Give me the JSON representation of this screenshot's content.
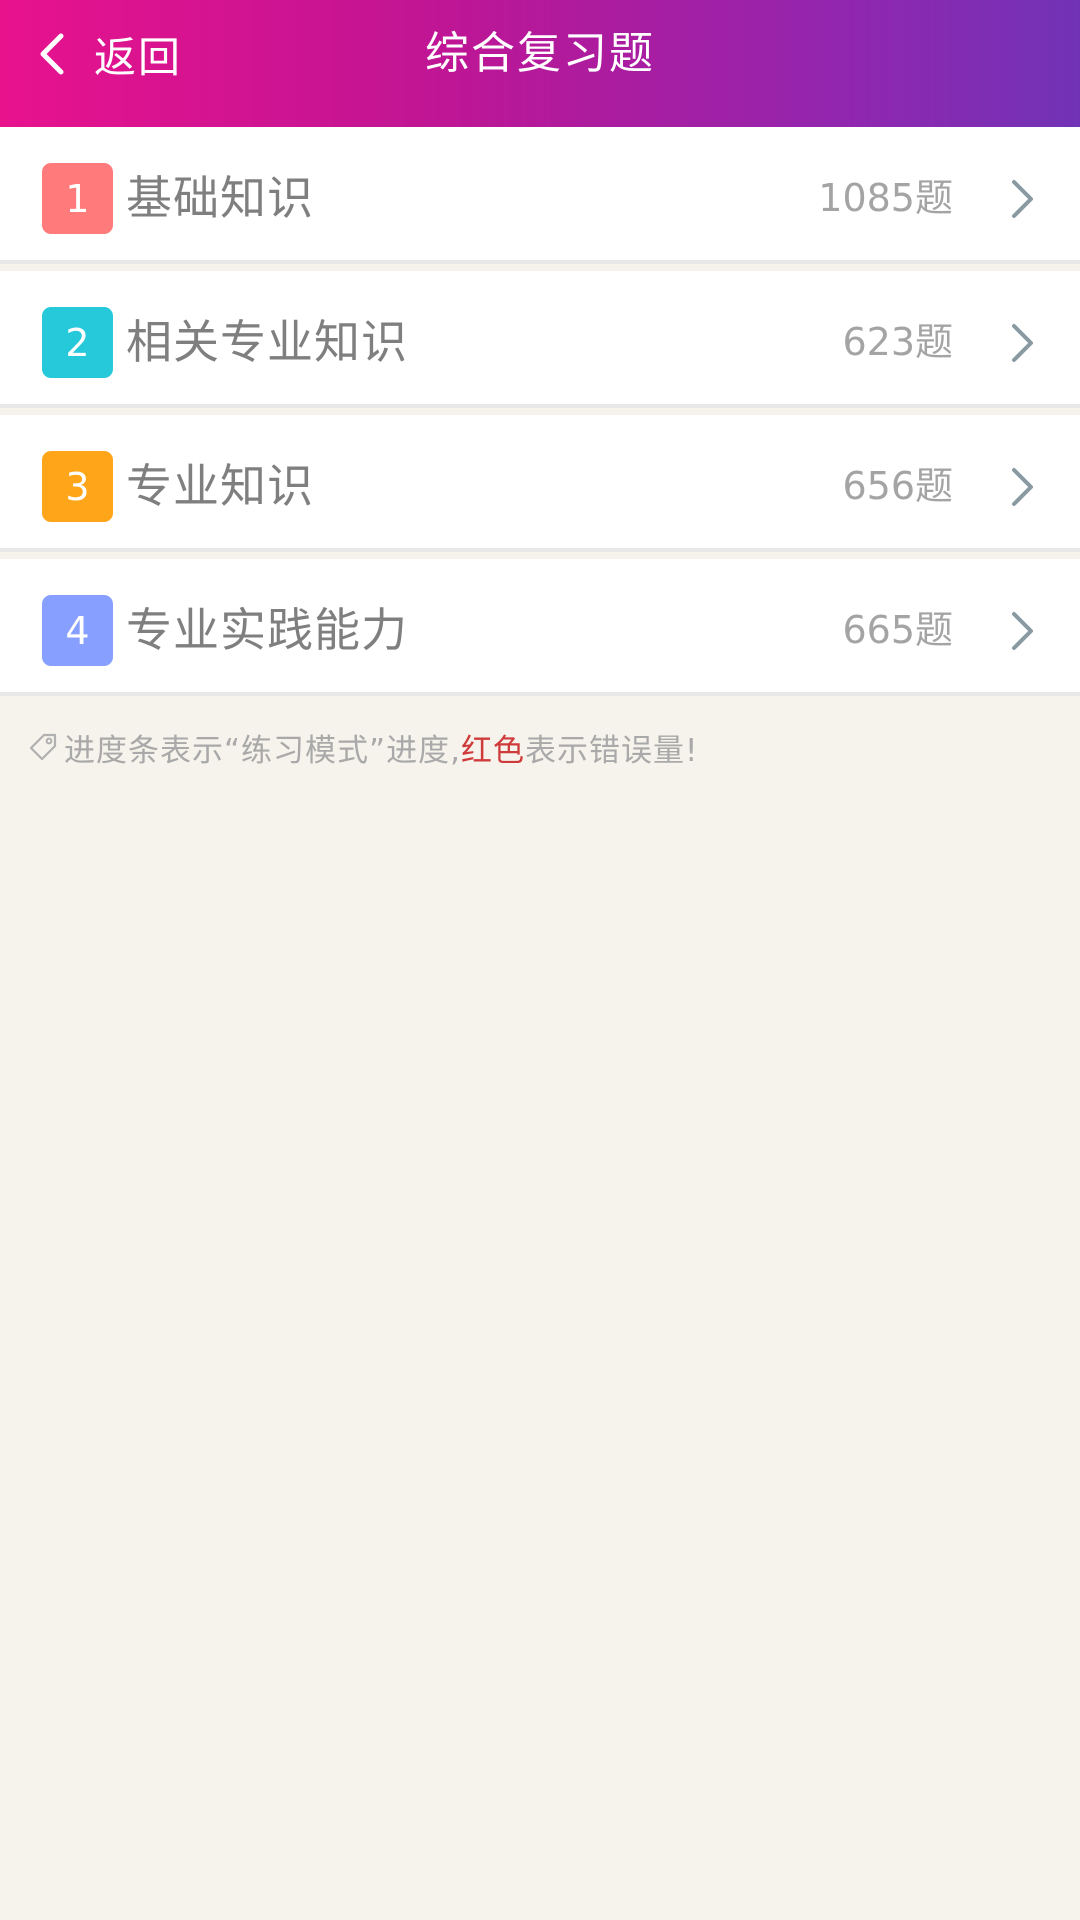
{
  "header": {
    "back_label": "返回",
    "title": "综合复习题"
  },
  "items": [
    {
      "number": "1",
      "name": "基础知识",
      "count": "1085题",
      "color": "#ff7a7a"
    },
    {
      "number": "2",
      "name": "相关专业知识",
      "count": "623题",
      "color": "#26c9da"
    },
    {
      "number": "3",
      "name": "专业知识",
      "count": "656题",
      "color": "#ffa51a"
    },
    {
      "number": "4",
      "name": "专业实践能力",
      "count": "665题",
      "color": "#87a0ff"
    }
  ],
  "tip": {
    "icon": "tag-icon",
    "part1": "进度条表示“练习模式”进度,",
    "highlight": "红色",
    "part2": "表示错误量!"
  },
  "colors": {
    "header_gradient_start": "#e8128d",
    "header_gradient_end": "#7133b6",
    "background": "#f6f3ec",
    "highlight_red": "#cf3b3b"
  }
}
